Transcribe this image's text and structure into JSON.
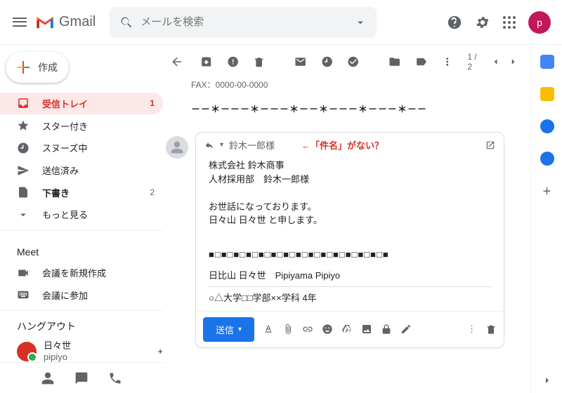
{
  "header": {
    "app_name": "Gmail",
    "search_placeholder": "メールを検索",
    "avatar_initial": "p"
  },
  "sidebar": {
    "compose_label": "作成",
    "nav": [
      {
        "label": "受信トレイ",
        "count": "1"
      },
      {
        "label": "スター付き",
        "count": ""
      },
      {
        "label": "スヌーズ中",
        "count": ""
      },
      {
        "label": "送信済み",
        "count": ""
      },
      {
        "label": "下書き",
        "count": "2"
      },
      {
        "label": "もっと見る",
        "count": ""
      }
    ],
    "meet_label": "Meet",
    "meet_items": [
      {
        "label": "会議を新規作成"
      },
      {
        "label": "会議に参加"
      }
    ],
    "hangouts_label": "ハングアウト",
    "hangouts_user_top": "日々世",
    "hangouts_user_bottom": "pipiyo"
  },
  "toolbar": {
    "counter": "1 / 2"
  },
  "body": {
    "fax_line": "FAX：0000-00-0000",
    "decor_line": "－－＊－－－＊－－－＊－－＊－－－＊－－－＊－－"
  },
  "compose_card": {
    "recipient": "鈴木一郎様",
    "annotation": "←「件名」がない？",
    "line1": "株式会社 鈴木商事",
    "line2": "人材採用部　鈴木一郎様",
    "line3": "お世話になっております。",
    "line4": "日々山 日々世 と申します。",
    "sig_sep": "■□■□■□■□■□■□■□■□■□■□■□■□■□■□■",
    "sig_name": "日比山 日々世　Pipiyama Pipiyo",
    "sig_school": "○△大学□□学部××学科 4年",
    "send_label": "送信"
  }
}
